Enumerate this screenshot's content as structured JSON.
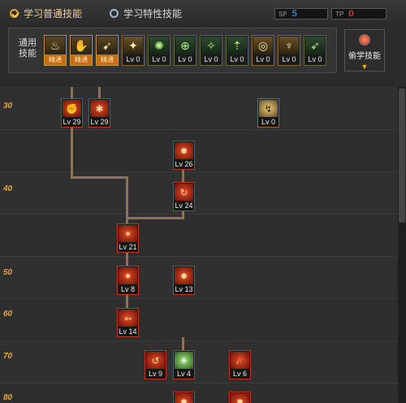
{
  "tabs": [
    {
      "label": "学习普通技能",
      "active": true
    },
    {
      "label": "学习特性技能",
      "active": false
    }
  ],
  "sp": {
    "label": "SP",
    "value": "5",
    "color": "#4fb0ff"
  },
  "tp": {
    "label": "TP",
    "value": "0",
    "color": "#ff5a3a"
  },
  "common": {
    "title": "通用技能",
    "skills": [
      {
        "icon": "rest-icon",
        "glyph": "♨",
        "level": "精通",
        "style": "master"
      },
      {
        "icon": "throw-icon",
        "glyph": "✋",
        "level": "精通",
        "style": "master"
      },
      {
        "icon": "sprint-icon",
        "glyph": "➹",
        "level": "精通",
        "style": "master"
      },
      {
        "icon": "wings-icon",
        "glyph": "✦",
        "level": "Lv 0",
        "style": "gold"
      },
      {
        "icon": "burst-icon",
        "glyph": "✺",
        "level": "Lv 0",
        "style": "green"
      },
      {
        "icon": "target-icon",
        "glyph": "⊕",
        "level": "Lv 0",
        "style": "green"
      },
      {
        "icon": "kick-icon",
        "glyph": "✧",
        "level": "Lv 0",
        "style": "green"
      },
      {
        "icon": "leap-icon",
        "glyph": "⇡",
        "level": "Lv 0",
        "style": "green"
      },
      {
        "icon": "ring-icon",
        "glyph": "◎",
        "level": "Lv 0",
        "style": "gold"
      },
      {
        "icon": "pose-icon",
        "glyph": "♆",
        "level": "Lv 0",
        "style": "gold"
      },
      {
        "icon": "dash-icon",
        "glyph": "➶",
        "level": "Lv 0",
        "style": "green"
      }
    ],
    "steal_label": "偷学技能"
  },
  "tree": {
    "row_labels": [
      "30",
      "40",
      "50",
      "60",
      "70",
      "80"
    ],
    "skills": [
      {
        "icon": "fist-icon",
        "glyph": "✊",
        "level": "Lv 29",
        "style": "red"
      },
      {
        "icon": "punch-icon",
        "glyph": "✱",
        "level": "Lv 29",
        "style": "red"
      },
      {
        "icon": "slide-icon",
        "glyph": "↯",
        "level": "Lv 0",
        "style": "gold"
      },
      {
        "icon": "explosion-icon",
        "glyph": "✹",
        "level": "Lv 26",
        "style": "red"
      },
      {
        "icon": "spin-icon",
        "glyph": "↻",
        "level": "Lv 24",
        "style": "red"
      },
      {
        "icon": "roar-icon",
        "glyph": "✶",
        "level": "Lv 21",
        "style": "red"
      },
      {
        "icon": "fire-strike-icon",
        "glyph": "✷",
        "level": "Lv 8",
        "style": "red"
      },
      {
        "icon": "shockwave-icon",
        "glyph": "✸",
        "level": "Lv 13",
        "style": "red"
      },
      {
        "icon": "flame-rush-icon",
        "glyph": "➳",
        "level": "Lv 14",
        "style": "red"
      },
      {
        "icon": "flip-icon",
        "glyph": "↺",
        "level": "Lv 9",
        "style": "red"
      },
      {
        "icon": "green-burst-icon",
        "glyph": "✳",
        "level": "Lv 4",
        "style": "green"
      },
      {
        "icon": "grab-icon",
        "glyph": "☄",
        "level": "Lv 6",
        "style": "red"
      },
      {
        "icon": "partial-skill-icon",
        "glyph": "✹",
        "level": "",
        "style": "red"
      },
      {
        "icon": "partial-skill-icon",
        "glyph": "✹",
        "level": "",
        "style": "red"
      }
    ]
  }
}
